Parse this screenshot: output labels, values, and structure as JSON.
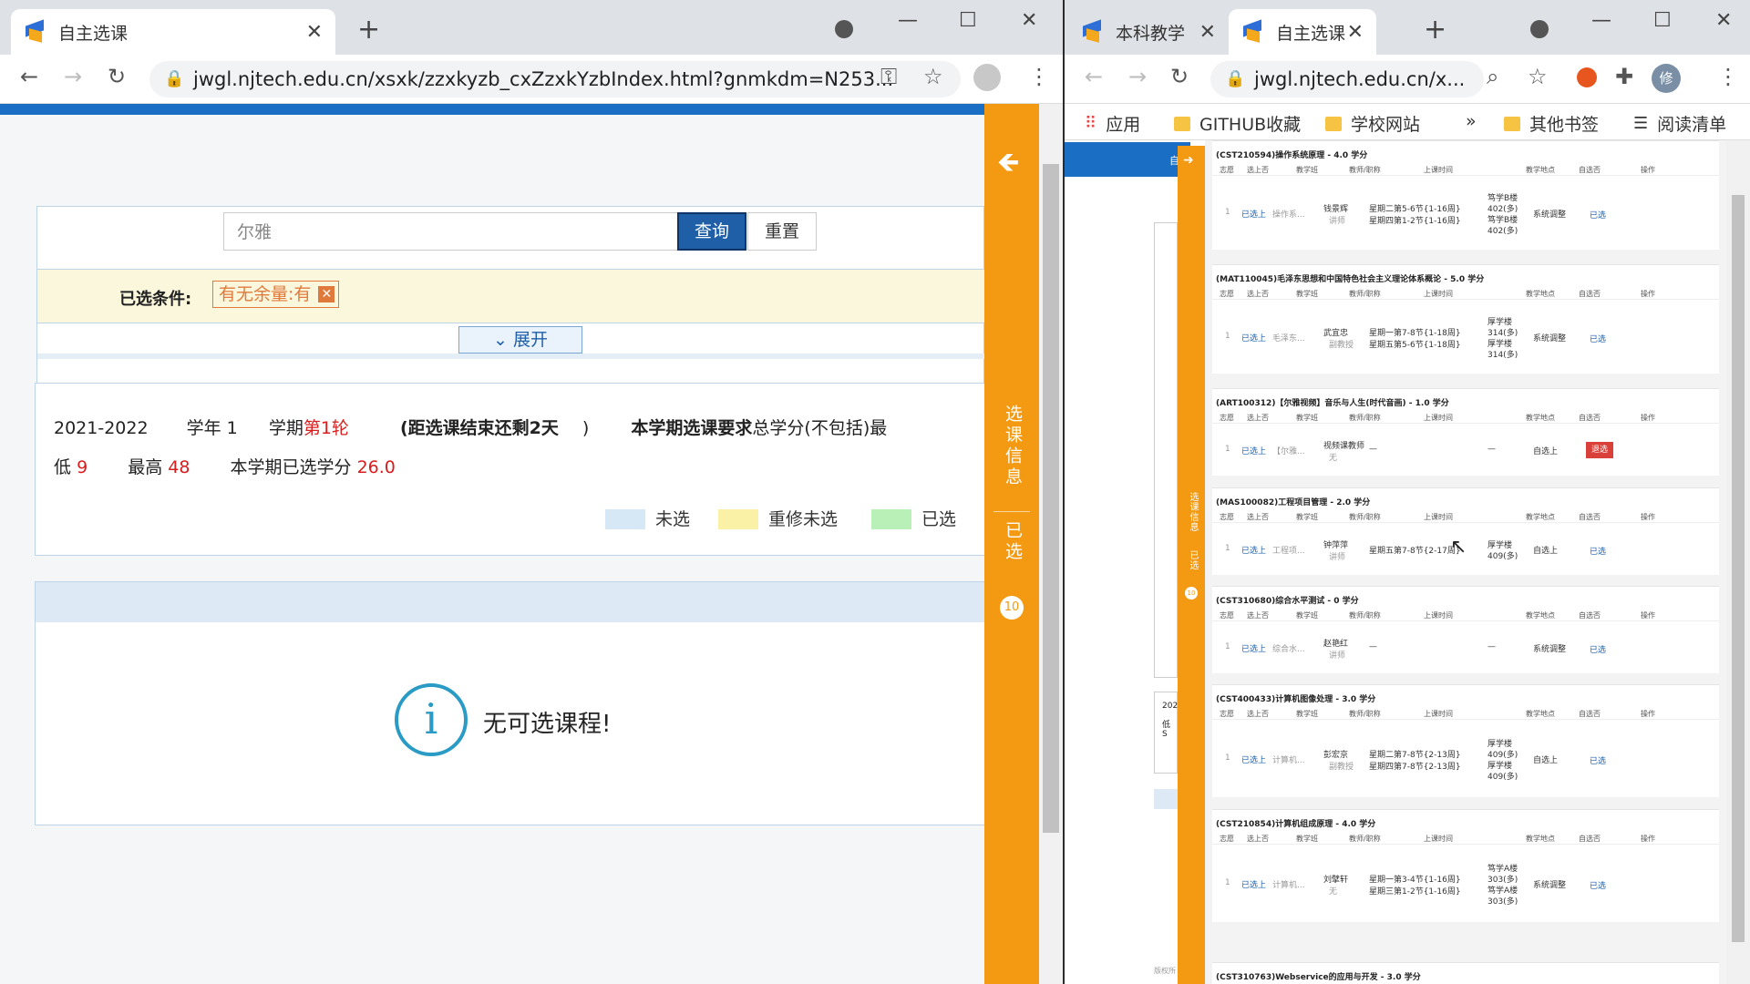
{
  "left_window": {
    "tab_title": "自主选课",
    "url": "jwgl.njtech.edu.cn/xsxk/zzxkyzb_cxZzxkYzbIndex.html?gnmkdm=N253...",
    "search_value": "尔雅",
    "query_label": "查询",
    "reset_label": "重置",
    "selected_conditions_label": "已选条件:",
    "condition_tag": "有无余量:有",
    "expand_label": "展开",
    "info": {
      "academic_year": "2021-2022",
      "year_label": "学年 1",
      "term_label": "学期",
      "round": "第1轮",
      "countdown": "(距选课结束还剩2天",
      "countdown_close": ")",
      "requirement_bold": "本学期选课要求",
      "requirement_rest": "总学分(不包括)最",
      "min_label": "低",
      "min_value": "9",
      "max_label": "最高",
      "max_value": "48",
      "selected_credits_label": "本学期已选学分",
      "selected_credits_value": "26.0"
    },
    "legend": [
      {
        "label": "未选",
        "color": "#d6e8f5"
      },
      {
        "label": "重修未选",
        "color": "#fbf1a6"
      },
      {
        "label": "已选",
        "color": "#b8f0b8"
      }
    ],
    "empty_message": "无可选课程!",
    "side_panel": {
      "title": "选课信息",
      "selected": "已选",
      "count": "10"
    }
  },
  "right_window": {
    "tabs": [
      {
        "title": "本科教学",
        "active": false
      },
      {
        "title": "自主选课",
        "active": true
      }
    ],
    "url": "jwgl.njtech.edu.cn/x...",
    "avatar_letter": "修",
    "bookmarks": [
      "应用",
      "GITHUB收藏",
      "学校网站",
      "»",
      "其他书签",
      "阅读清单"
    ],
    "side_panel": {
      "title": "选课信息",
      "selected": "已选",
      "count": "10"
    },
    "column_headers": [
      "志愿",
      "选上否",
      "教学班",
      "教师/职称",
      "上课时间",
      "教学地点",
      "自选否",
      "操作"
    ],
    "courses": [
      {
        "title": "(CST210594)操作系统原理 - 4.0 学分",
        "volunteer": "1",
        "status": "已选上",
        "class": "操作系...",
        "teacher": "钱景辉",
        "rank": "讲师",
        "time1": "星期二第5-6节{1-16周}",
        "time2": "星期四第1-2节{1-16周}",
        "place1": "笃学B楼",
        "place2": "402(多)",
        "place3": "笃学B楼",
        "place4": "402(多)",
        "self": "系统调整",
        "action": "已选"
      },
      {
        "title": "(MAT110045)毛泽东思想和中国特色社会主义理论体系概论 - 5.0 学分",
        "volunteer": "1",
        "status": "已选上",
        "class": "毛泽东...",
        "teacher": "武宜忠",
        "rank": "副教授",
        "time1": "星期一第7-8节{1-18周}",
        "time2": "星期五第5-6节{1-18周}",
        "place1": "厚学楼",
        "place2": "314(多)",
        "place3": "厚学楼",
        "place4": "314(多)",
        "self": "系统调整",
        "action": "已选"
      },
      {
        "title": "(ART100312)【尔雅视频】音乐与人生(时代音画) - 1.0 学分",
        "volunteer": "1",
        "status": "已选上",
        "class": "【尔雅...",
        "teacher": "视频课教师",
        "rank": "无",
        "time1": "—",
        "time2": "",
        "place1": "—",
        "place2": "",
        "place3": "",
        "place4": "",
        "self": "自选上",
        "action": "退选"
      },
      {
        "title": "(MAS100082)工程项目管理 - 2.0 学分",
        "volunteer": "1",
        "status": "已选上",
        "class": "工程项...",
        "teacher": "钟萍萍",
        "rank": "讲师",
        "time1": "星期五第7-8节{2-17周}",
        "time2": "",
        "place1": "厚学楼",
        "place2": "409(多)",
        "place3": "",
        "place4": "",
        "self": "自选上",
        "action": "已选"
      },
      {
        "title": "(CST310680)综合水平测试 - 0 学分",
        "volunteer": "1",
        "status": "已选上",
        "class": "综合水...",
        "teacher": "赵艳红",
        "rank": "讲师",
        "time1": "—",
        "time2": "",
        "place1": "—",
        "place2": "",
        "place3": "",
        "place4": "",
        "self": "系统调整",
        "action": "已选"
      },
      {
        "title": "(CST400433)计算机图像处理 - 3.0 学分",
        "volunteer": "1",
        "status": "已选上",
        "class": "计算机...",
        "teacher": "彭宏京",
        "rank": "副教授",
        "time1": "星期二第7-8节{2-13周}",
        "time2": "星期四第7-8节{2-13周}",
        "place1": "厚学楼",
        "place2": "409(多)",
        "place3": "厚学楼",
        "place4": "409(多)",
        "self": "自选上",
        "action": "已选"
      },
      {
        "title": "(CST210854)计算机组成原理 - 4.0 学分",
        "volunteer": "1",
        "status": "已选上",
        "class": "计算机...",
        "teacher": "刘擘轩",
        "rank": "无",
        "time1": "星期一第3-4节{1-16周}",
        "time2": "星期三第1-2节{1-16周}",
        "place1": "笃学A楼",
        "place2": "303(多)",
        "place3": "笃学A楼",
        "place4": "303(多)",
        "self": "系统调整",
        "action": "已选"
      }
    ],
    "last_course_title": "(CST310763)Webservice的应用与开发 - 3.0 学分",
    "peek_text_1": "202",
    "peek_text_2": "低 S",
    "peek_text_3": "自",
    "footer_text": "版权所"
  }
}
